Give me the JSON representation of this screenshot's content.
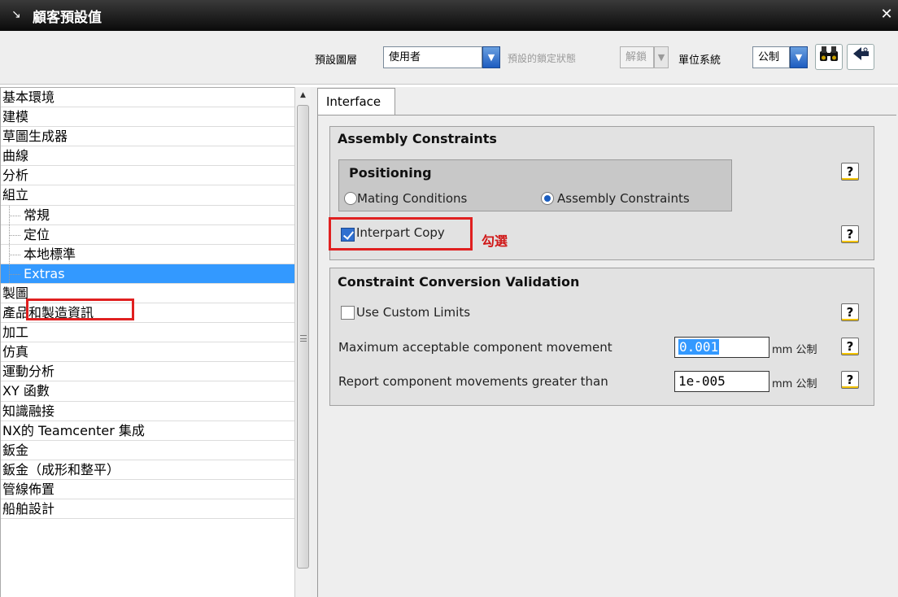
{
  "window": {
    "title": "顧客預設值",
    "close_label": "✕"
  },
  "toolbar": {
    "layer_label": "預設圖層",
    "layer_value": "使用者",
    "lock_state_label": "預設的鎖定狀態",
    "lock_state_value": "解鎖",
    "unit_label": "單位系統",
    "unit_value": "公制",
    "find_icon": "binoculars-icon",
    "back_icon": "back-arrow-icon"
  },
  "sidebar": {
    "items": [
      {
        "label": "基本環境"
      },
      {
        "label": "建模"
      },
      {
        "label": "草圖生成器"
      },
      {
        "label": "曲線"
      },
      {
        "label": "分析"
      },
      {
        "label": "組立"
      },
      {
        "label": "常規"
      },
      {
        "label": "定位"
      },
      {
        "label": "本地標準"
      },
      {
        "label": "Extras"
      },
      {
        "label": "製圖"
      },
      {
        "label": "產品和製造資訊"
      },
      {
        "label": "加工"
      },
      {
        "label": "仿真"
      },
      {
        "label": "運動分析"
      },
      {
        "label": "XY 函數"
      },
      {
        "label": "知識融接"
      },
      {
        "label": "NX的 Teamcenter 集成"
      },
      {
        "label": "鈑金"
      },
      {
        "label": "鈑金（成形和整平）"
      },
      {
        "label": "管線佈置"
      },
      {
        "label": "船舶設計"
      }
    ],
    "selected": "Extras"
  },
  "tabs": [
    {
      "label": "Interface"
    }
  ],
  "assembly_constraints": {
    "title": "Assembly Constraints",
    "positioning": {
      "title": "Positioning",
      "option_mating": "Mating Conditions",
      "option_assembly": "Assembly Constraints",
      "selected": "Assembly Constraints"
    },
    "interpart_copy": {
      "label": "Interpart Copy",
      "checked": true
    },
    "annotation": "勾選"
  },
  "conversion_validation": {
    "title": "Constraint Conversion Validation",
    "use_custom_limits": {
      "label": "Use Custom Limits",
      "checked": false
    },
    "max_movement": {
      "label": "Maximum acceptable component movement",
      "value": "0.001",
      "unit": "mm 公制"
    },
    "report_movement": {
      "label": "Report component movements greater than",
      "value": "1e-005",
      "unit": "mm 公制"
    }
  },
  "help_label": "?",
  "colors": {
    "selection": "#3399ff",
    "highlight_box": "#e02020",
    "annotation": "#d01818"
  }
}
